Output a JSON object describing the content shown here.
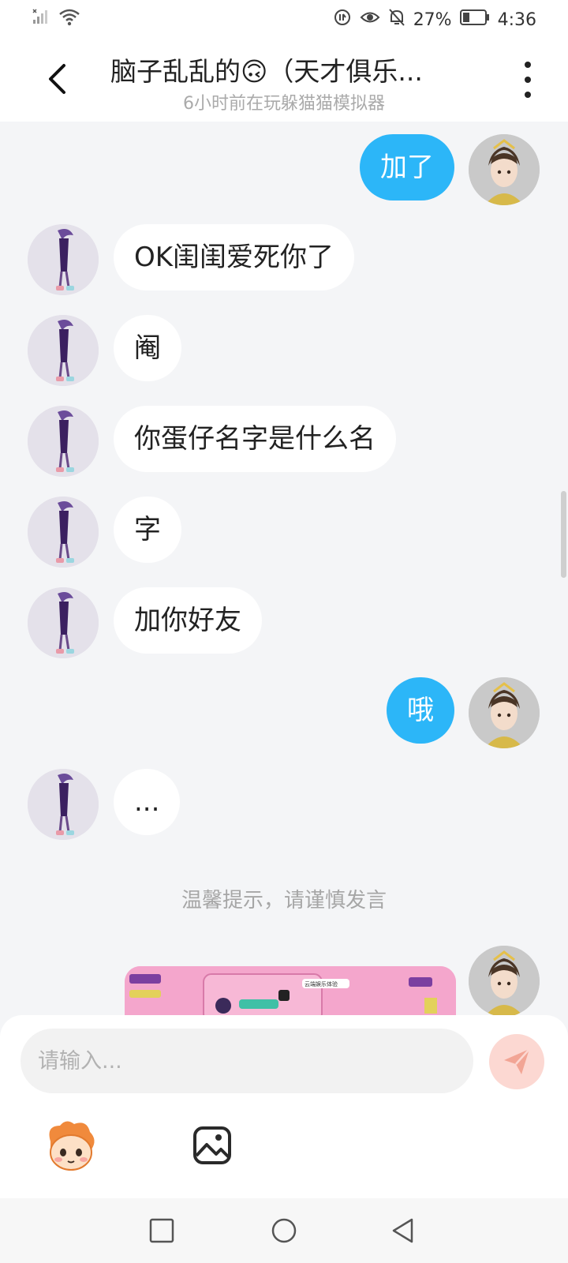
{
  "status_bar": {
    "battery": "27%",
    "time": "4:36",
    "icons": [
      "no-sim-icon",
      "wifi-icon",
      "data-saver-icon",
      "eye-icon",
      "mute-icon",
      "battery-icon"
    ]
  },
  "header": {
    "title": "脑子乱乱的🙃（天才俱乐...",
    "subtitle": "6小时前在玩躲猫猫模拟器"
  },
  "messages": [
    {
      "side": "self",
      "text": "加了"
    },
    {
      "side": "other",
      "text": "OK闺闺爱死你了"
    },
    {
      "side": "other",
      "text": "阉"
    },
    {
      "side": "other",
      "text": "你蛋仔名字是什么名"
    },
    {
      "side": "other",
      "text": "字"
    },
    {
      "side": "other",
      "text": "加你好友"
    },
    {
      "side": "self",
      "text": "哦"
    },
    {
      "side": "other",
      "text": "..."
    }
  ],
  "tip": "温馨提示，请谨慎发言",
  "image_message_text": "云端娱乐体验",
  "input": {
    "placeholder": "请输入..."
  },
  "colors": {
    "self_bubble": "#2cb6f8",
    "send_button": "#fcd8d2",
    "send_icon": "#f2a595"
  }
}
